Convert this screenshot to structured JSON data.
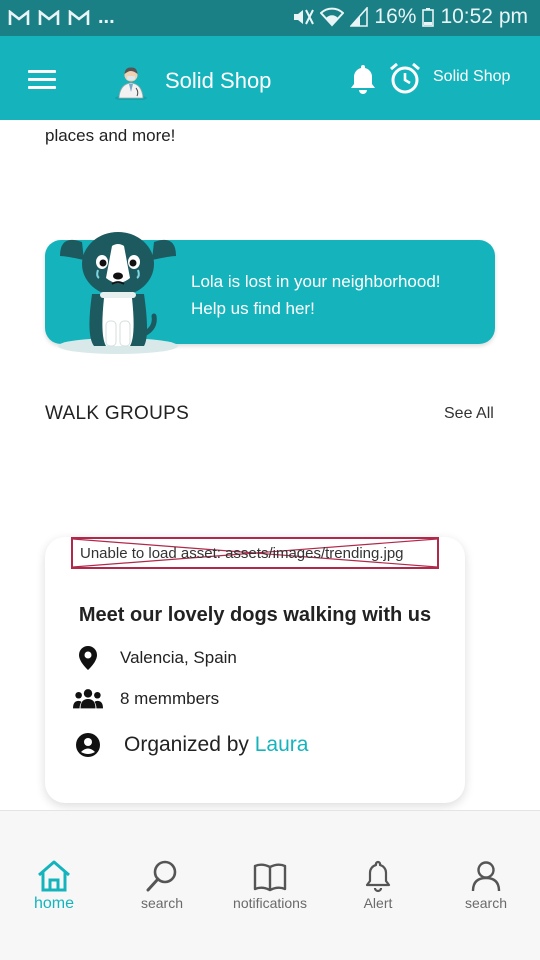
{
  "status_bar": {
    "left_icons": [
      "gmail-icon",
      "gmail-icon",
      "gmail-icon"
    ],
    "dots": "...",
    "battery": "16%",
    "time": "10:52 pm"
  },
  "app_bar": {
    "title": "Solid Shop",
    "right_title": "Solid Shop"
  },
  "intro_text": "places and more!",
  "lost_banner": {
    "line1": "Lola is lost in your neighborhood!",
    "line2": "Help us find her!"
  },
  "walk_groups": {
    "title": "WALK GROUPS",
    "see_all": "See All"
  },
  "card": {
    "asset_error": "Unable to load asset: assets/images/trending.jpg",
    "title": "Meet our lovely dogs walking with us",
    "location": "Valencia, Spain",
    "members": "8 memmbers",
    "organizer_prefix": "Organized by",
    "organizer_name": "Laura"
  },
  "bottom_nav": [
    {
      "label": "home",
      "icon": "home-icon",
      "active": true
    },
    {
      "label": "search",
      "icon": "search-icon",
      "active": false
    },
    {
      "label": "notifications",
      "icon": "book-icon",
      "active": false
    },
    {
      "label": "Alert",
      "icon": "bell-icon",
      "active": false
    },
    {
      "label": "search",
      "icon": "person-icon",
      "active": false
    }
  ],
  "colors": {
    "primary": "#15b4bd",
    "status_bar": "#1b7f86",
    "error_border": "#b0294a"
  }
}
